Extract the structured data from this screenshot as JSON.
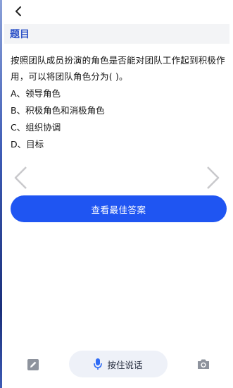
{
  "header": {
    "back_icon": "chevron-left-icon"
  },
  "section": {
    "title": "题目"
  },
  "question": {
    "text": "按照团队成员扮演的角色是否能对团队工作起到积极作用，可以将团队角色分为( )。",
    "options": [
      "A、领导角色",
      "B、积极角色和消极角色",
      "C、组织协调",
      "D、目标"
    ]
  },
  "navigation": {
    "prev_icon": "chevron-left-icon",
    "next_icon": "chevron-right-icon"
  },
  "actions": {
    "view_answer_label": "查看最佳答案",
    "accent_color": "#1f55f2"
  },
  "bottom_bar": {
    "edit_icon": "edit-icon",
    "voice_icon": "microphone-icon",
    "voice_label": "按住说话",
    "camera_icon": "camera-icon"
  }
}
